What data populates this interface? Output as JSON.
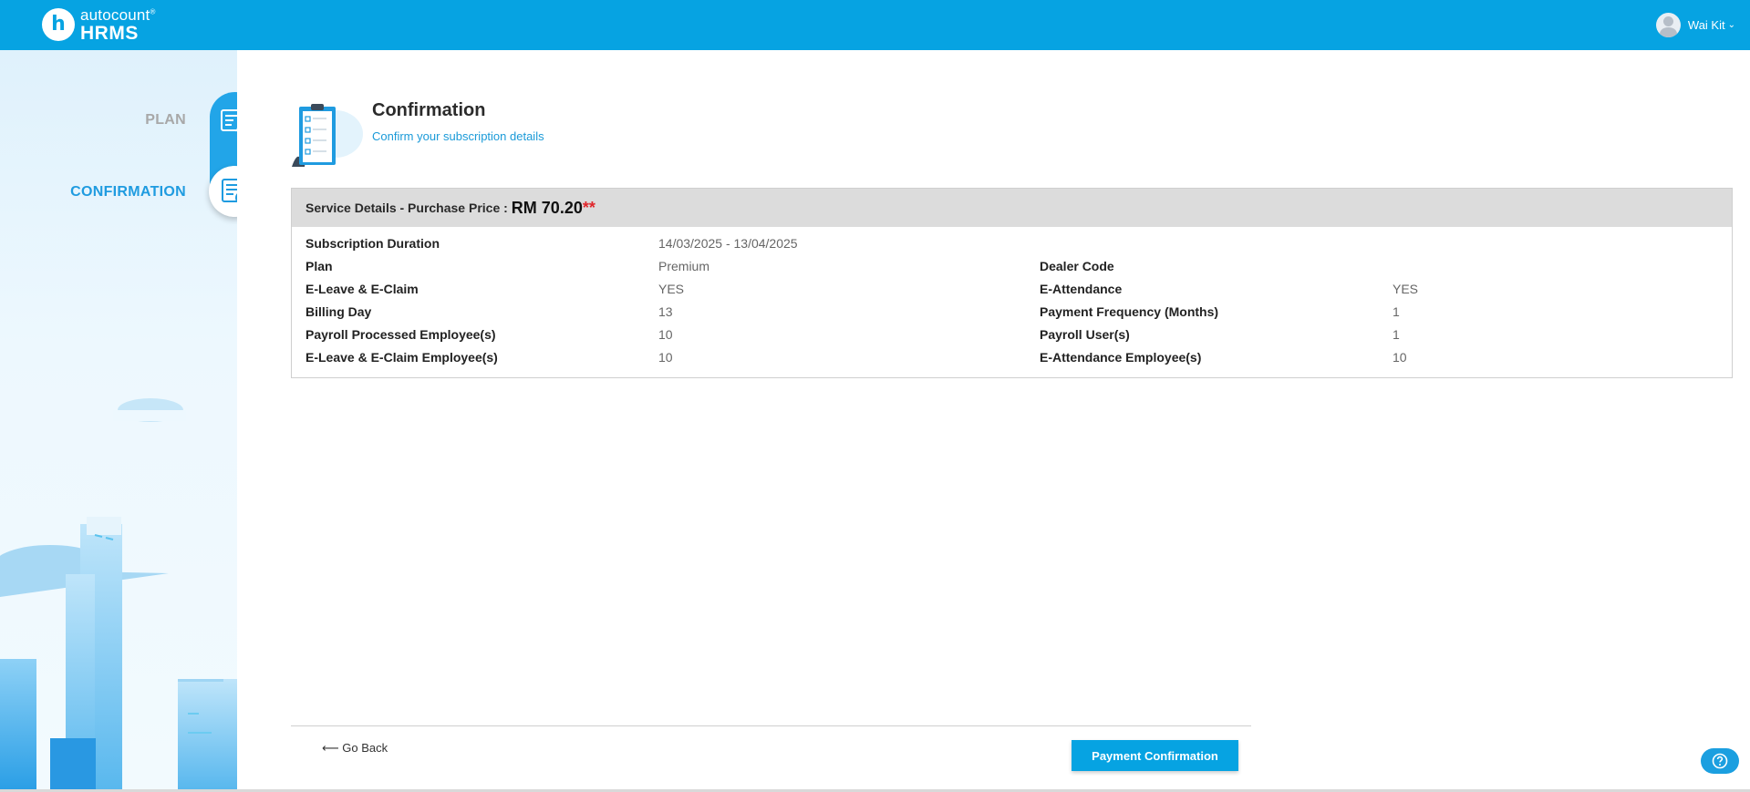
{
  "brand": {
    "top": "autocount",
    "reg": "®",
    "bottom": "HRMS",
    "letter": "h"
  },
  "user": {
    "name": "Wai Kit",
    "caret": "⌄"
  },
  "steps": [
    {
      "label": "PLAN",
      "state": "done"
    },
    {
      "label": "CONFIRMATION",
      "state": "active"
    }
  ],
  "header": {
    "title": "Confirmation",
    "subtitle": "Confirm your subscription details"
  },
  "service": {
    "heading": "Service Details - Purchase Price :",
    "price": "RM 70.20",
    "stars": "**",
    "left": [
      {
        "label": "Subscription Duration",
        "value": "14/03/2025 - 13/04/2025"
      },
      {
        "label": "Plan",
        "value": "Premium"
      },
      {
        "label": "E-Leave & E-Claim",
        "value": "YES"
      },
      {
        "label": "Billing Day",
        "value": "13"
      },
      {
        "label": "Payroll Processed Employee(s)",
        "value": "10"
      },
      {
        "label": "E-Leave & E-Claim Employee(s)",
        "value": "10"
      }
    ],
    "right": [
      {
        "label": "Dealer Code",
        "value": ""
      },
      {
        "label": "E-Attendance",
        "value": "YES"
      },
      {
        "label": "Payment Frequency (Months)",
        "value": "1"
      },
      {
        "label": "Payroll User(s)",
        "value": "1"
      },
      {
        "label": "E-Attendance Employee(s)",
        "value": "10"
      }
    ]
  },
  "footer": {
    "go_back": "⟵ Go Back",
    "payment_button": "Payment Confirmation"
  },
  "colors": {
    "primary": "#06a3e2",
    "accent_text": "#1a9ad8",
    "price_stars": "#e0262b"
  },
  "icons": [
    "logo-h-icon",
    "user-avatar-icon",
    "chevron-down-icon",
    "plan-step-icon",
    "confirmation-step-icon",
    "clipboard-checklist-icon",
    "help-icon"
  ]
}
